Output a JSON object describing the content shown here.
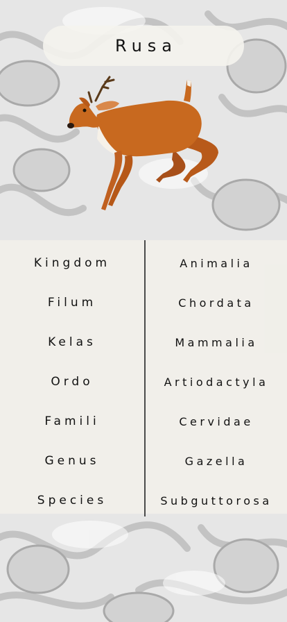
{
  "title": "Rusa",
  "taxonomy": [
    {
      "rank": "Kingdom",
      "value": "Animalia"
    },
    {
      "rank": "Filum",
      "value": "Chordata"
    },
    {
      "rank": "Kelas",
      "value": "Mammalia"
    },
    {
      "rank": "Ordo",
      "value": "Artiodactyla"
    },
    {
      "rank": "Famili",
      "value": "Cervidae"
    },
    {
      "rank": "Genus",
      "value": "Gazella"
    },
    {
      "rank": "Species",
      "value": "Subguttorosa"
    }
  ],
  "colors": {
    "background": "#e9e9e9",
    "pattern": "#bdbdbd",
    "panel": "#f2f0ea",
    "text": "#111111",
    "deer_body": "#c8691f"
  },
  "icons": {
    "animal": "deer-icon"
  }
}
